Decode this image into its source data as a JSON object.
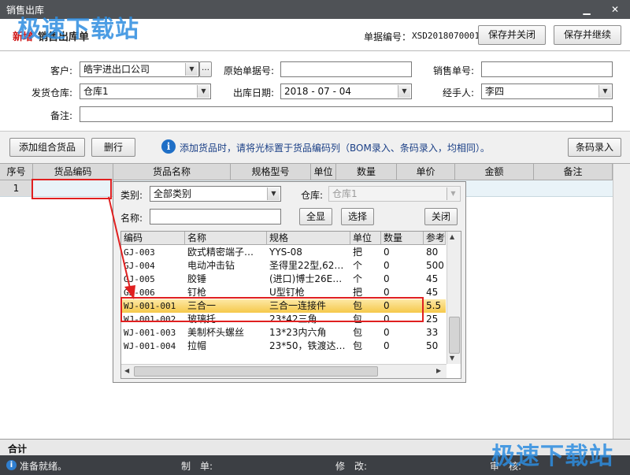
{
  "window": {
    "title": "销售出库"
  },
  "header": {
    "mode_tag": "新增",
    "doc_title": "销售出库单",
    "doc_no_label": "单据编号：",
    "doc_no": "XSD2018070001",
    "save_close": "保存并关闭",
    "save_continue": "保存并继续"
  },
  "form": {
    "customer_label": "客户:",
    "customer": "皓宇进出口公司",
    "orig_no_label": "原始单据号:",
    "orig_no": "",
    "sales_no_label": "销售单号:",
    "sales_no": "",
    "warehouse_label": "发货仓库:",
    "warehouse": "仓库1",
    "date_label": "出库日期:",
    "date": "2018 - 07 - 04",
    "handler_label": "经手人:",
    "handler": "李四",
    "remark_label": "备注:",
    "remark": ""
  },
  "toolbar": {
    "add_combo": "添加组合货品",
    "delete_row": "删行",
    "info": "添加货品时，请将光标置于货品编码列（BOM录入、条码录入，均相同）。",
    "barcode": "条码录入"
  },
  "grid": {
    "columns": [
      "序号",
      "货品编码",
      "货品名称",
      "规格型号",
      "单位",
      "数量",
      "单价",
      "金额",
      "备注"
    ],
    "rows": [
      {
        "no": "1"
      }
    ]
  },
  "popup": {
    "category_label": "类别:",
    "category": "全部类别",
    "warehouse_label": "仓库:",
    "warehouse": "仓库1",
    "name_label": "名称:",
    "name_value": "",
    "btn_all": "全显",
    "btn_select": "选择",
    "btn_close": "关闭",
    "columns": [
      "编码",
      "名称",
      "规格",
      "单位",
      "数量",
      "参考"
    ],
    "rows": [
      {
        "code": "GJ-003",
        "name": "欧式精密端子…",
        "spec": "YYS-08",
        "unit": "把",
        "qty": "0",
        "ref": "80"
      },
      {
        "code": "GJ-004",
        "name": "电动冲击钻",
        "spec": "圣得里22型,62…",
        "unit": "个",
        "qty": "0",
        "ref": "500"
      },
      {
        "code": "GJ-005",
        "name": "胶锤",
        "spec": "(进口)博士26E…",
        "unit": "个",
        "qty": "0",
        "ref": "45"
      },
      {
        "code": "GJ-006",
        "name": "钉枪",
        "spec": "U型钉枪",
        "unit": "把",
        "qty": "0",
        "ref": "45"
      },
      {
        "code": "WJ-001-001",
        "name": "三合一",
        "spec": "三合一连接件",
        "unit": "包",
        "qty": "0",
        "ref": "5.5"
      },
      {
        "code": "WJ-001-002",
        "name": "玻璃托",
        "spec": "23*42三角",
        "unit": "包",
        "qty": "0",
        "ref": "25"
      },
      {
        "code": "WJ-001-003",
        "name": "美制杯头螺丝",
        "spec": "13*23内六角",
        "unit": "包",
        "qty": "0",
        "ref": "33"
      },
      {
        "code": "WJ-001-004",
        "name": "拉帽",
        "spec": "23*50，铁渡达…",
        "unit": "包",
        "qty": "0",
        "ref": "50"
      }
    ],
    "selected_index": 4
  },
  "footer": {
    "total_label": "合计",
    "status": "准备就绪。",
    "maker_label": "制　单:",
    "modify_label": "修　改:",
    "audit_label": "审　核:"
  },
  "watermark": {
    "text": "极速下载站"
  },
  "colors": {
    "titlebar": "#4f5256",
    "highlight": "#f5c84a",
    "annotation": "#e02020",
    "watermark": "#2d8de0"
  }
}
